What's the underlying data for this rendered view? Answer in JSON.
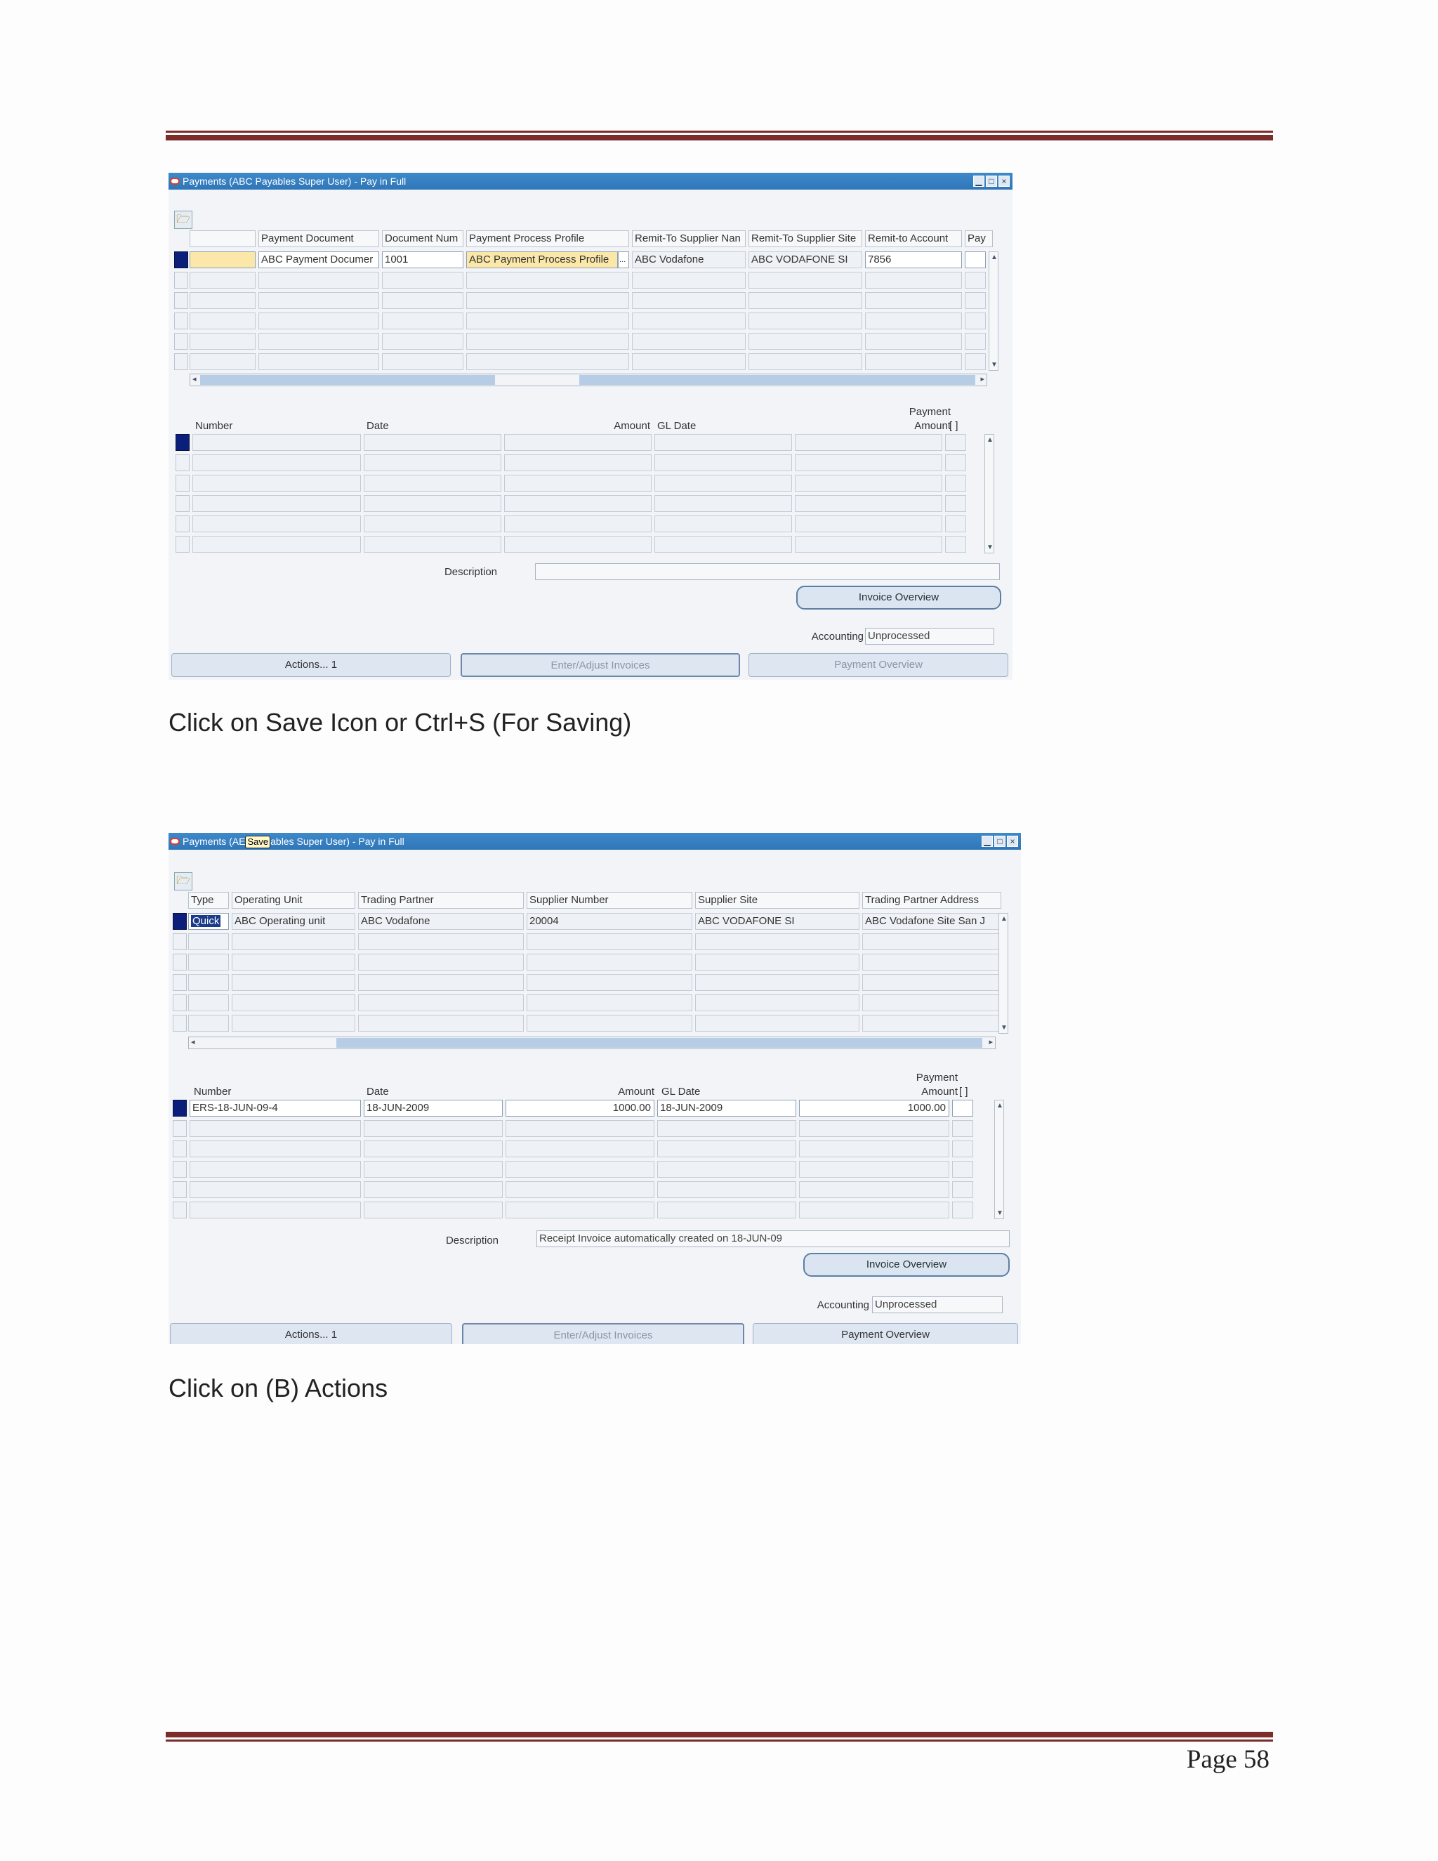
{
  "caption1": "Click on Save Icon or Ctrl+S (For Saving)",
  "caption2": "Click on (B) Actions",
  "page_number": "Page 58",
  "shot1": {
    "window_title": "Payments (ABC Payables Super User) - Pay in Full",
    "columns": [
      "Payment Document",
      "Document Num",
      "Payment Process Profile",
      "Remit-To Supplier Nan",
      "Remit-To Supplier Site",
      "Remit-to Account",
      "Pay"
    ],
    "row": [
      "ABC Payment Documer",
      "1001",
      "ABC Payment Process Profile",
      "ABC Vodafone",
      "ABC VODAFONE SI",
      "7856",
      ""
    ],
    "lov_glyph": "...",
    "inv": {
      "number": "Number",
      "date": "Date",
      "amount": "Amount",
      "gl_date": "GL Date",
      "payment": "Payment",
      "payment_amount": "Amount",
      "brackets": "[ ]"
    },
    "description_label": "Description",
    "description_value": "",
    "invoice_overview": "Invoice Overview",
    "accounting_label": "Accounting",
    "accounting_value": "Unprocessed",
    "actions": "Actions... 1",
    "enter_adjust": "Enter/Adjust Invoices",
    "payment_overview": "Payment Overview"
  },
  "shot2": {
    "window_title_a": "Payments (AE",
    "save_tooltip": "Save",
    "window_title_b": "ables Super User) - Pay in Full",
    "columns": [
      "Type",
      "Operating Unit",
      "Trading Partner",
      "Supplier Number",
      "Supplier Site",
      "Trading Partner Address"
    ],
    "row": [
      "Quick",
      "ABC Operating unit",
      "ABC Vodafone",
      "20004",
      "ABC VODAFONE SI",
      "ABC Vodafone Site  San J"
    ],
    "inv": {
      "number": "Number",
      "date": "Date",
      "amount": "Amount",
      "gl_date": "GL Date",
      "payment": "Payment",
      "payment_amount": "Amount",
      "brackets": "[ ]",
      "row": [
        "ERS-18-JUN-09-4",
        "18-JUN-2009",
        "1000.00",
        "18-JUN-2009",
        "1000.00"
      ]
    },
    "description_label": "Description",
    "description_value": "Receipt Invoice automatically created on 18-JUN-09",
    "invoice_overview": "Invoice Overview",
    "accounting_label": "Accounting",
    "accounting_value": "Unprocessed",
    "actions": "Actions... 1",
    "enter_adjust": "Enter/Adjust Invoices",
    "payment_overview": "Payment Overview"
  }
}
